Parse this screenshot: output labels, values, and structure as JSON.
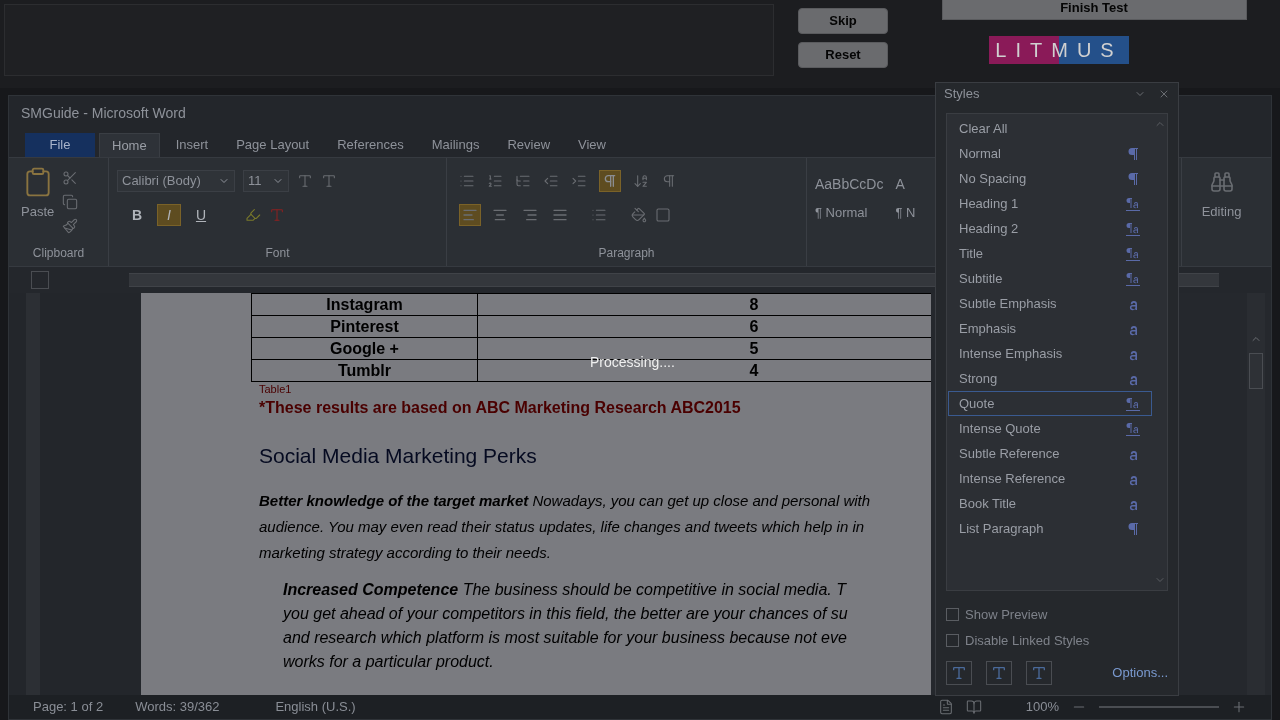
{
  "test_bar": {
    "buttons": [
      "Skip",
      "Reset"
    ],
    "finish_button": "Finish Test",
    "logo": "LITMUS"
  },
  "window": {
    "title": "SMGuide - Microsoft Word"
  },
  "ribbon_tabs": [
    {
      "label": "File",
      "selected": false,
      "kind": "file"
    },
    {
      "label": "Home",
      "selected": true,
      "kind": "tab"
    },
    {
      "label": "Insert",
      "selected": false,
      "kind": "tab"
    },
    {
      "label": "Page Layout",
      "selected": false,
      "kind": "tab"
    },
    {
      "label": "References",
      "selected": false,
      "kind": "tab"
    },
    {
      "label": "Mailings",
      "selected": false,
      "kind": "tab"
    },
    {
      "label": "Review",
      "selected": false,
      "kind": "tab"
    },
    {
      "label": "View",
      "selected": false,
      "kind": "tab"
    }
  ],
  "clipboard": {
    "paste": "Paste",
    "label": "Clipboard"
  },
  "font": {
    "name": "Calibri (Body)",
    "size": "11",
    "label": "Font",
    "format_buttons": [
      {
        "label": "B",
        "selected": false
      },
      {
        "label": "I",
        "selected": true
      },
      {
        "label": "U",
        "selected": false
      }
    ]
  },
  "paragraph": {
    "label": "Paragraph",
    "show_marks_on": true,
    "alignment": [
      {
        "selected": true
      },
      {
        "selected": false
      },
      {
        "selected": false
      },
      {
        "selected": false
      }
    ]
  },
  "styles_gallery": [
    {
      "sample": "AaBbCcDc",
      "name": "¶ Normal"
    },
    {
      "sample": "A",
      "name": "¶ N"
    }
  ],
  "editing": {
    "label": "Editing"
  },
  "table": {
    "rows": [
      {
        "name": "Instagram",
        "value": "8"
      },
      {
        "name": "Pinterest",
        "value": "6"
      },
      {
        "name": "Google +",
        "value": "5"
      },
      {
        "name": "Tumblr",
        "value": "4"
      }
    ]
  },
  "caption": "Table1",
  "note": "*These results are based on ABC Marketing Research ABC2015",
  "heading": "Social Media Marketing Perks",
  "paragraphs": [
    {
      "kind": "normal",
      "lines": [
        "**Better knowledge of the target market** Nowadays, you can get up close and personal with",
        "audience. You may even read their status updates, life changes and tweets which help in in",
        "marketing strategy according to their needs."
      ]
    },
    {
      "kind": "quote",
      "lines": [
        "**Increased Competence** The business should be competitive in social media. T",
        "you get ahead of your competitors in this field, the better are your chances of su",
        "and research which platform is most suitable for your business because not eve",
        "works for a particular product."
      ]
    }
  ],
  "overlay": {
    "message": "Processing...."
  },
  "styles_pane": {
    "title": "Styles",
    "items": [
      {
        "name": "Clear All",
        "kind": "none",
        "selected": false
      },
      {
        "name": "Normal",
        "kind": "paragraph",
        "selected": false
      },
      {
        "name": "No Spacing",
        "kind": "paragraph",
        "selected": false
      },
      {
        "name": "Heading 1",
        "kind": "linked",
        "selected": false
      },
      {
        "name": "Heading 2",
        "kind": "linked",
        "selected": false
      },
      {
        "name": "Title",
        "kind": "linked",
        "selected": false
      },
      {
        "name": "Subtitle",
        "kind": "linked",
        "selected": false
      },
      {
        "name": "Subtle Emphasis",
        "kind": "character",
        "selected": false
      },
      {
        "name": "Emphasis",
        "kind": "character",
        "selected": false
      },
      {
        "name": "Intense Emphasis",
        "kind": "character",
        "selected": false
      },
      {
        "name": "Strong",
        "kind": "character",
        "selected": false
      },
      {
        "name": "Quote",
        "kind": "linked",
        "selected": true
      },
      {
        "name": "Intense Quote",
        "kind": "linked",
        "selected": false
      },
      {
        "name": "Subtle Reference",
        "kind": "character",
        "selected": false
      },
      {
        "name": "Intense Reference",
        "kind": "character",
        "selected": false
      },
      {
        "name": "Book Title",
        "kind": "character",
        "selected": false
      },
      {
        "name": "List Paragraph",
        "kind": "paragraph",
        "selected": false
      }
    ],
    "options": [
      {
        "label": "Show Preview",
        "checked": false
      },
      {
        "label": "Disable Linked Styles",
        "checked": false
      }
    ],
    "options_link": "Options..."
  },
  "status_bar": {
    "page": "Page: 1 of 2",
    "words": "Words: 39/362",
    "language": "English (U.S.)",
    "zoom": "100%"
  }
}
